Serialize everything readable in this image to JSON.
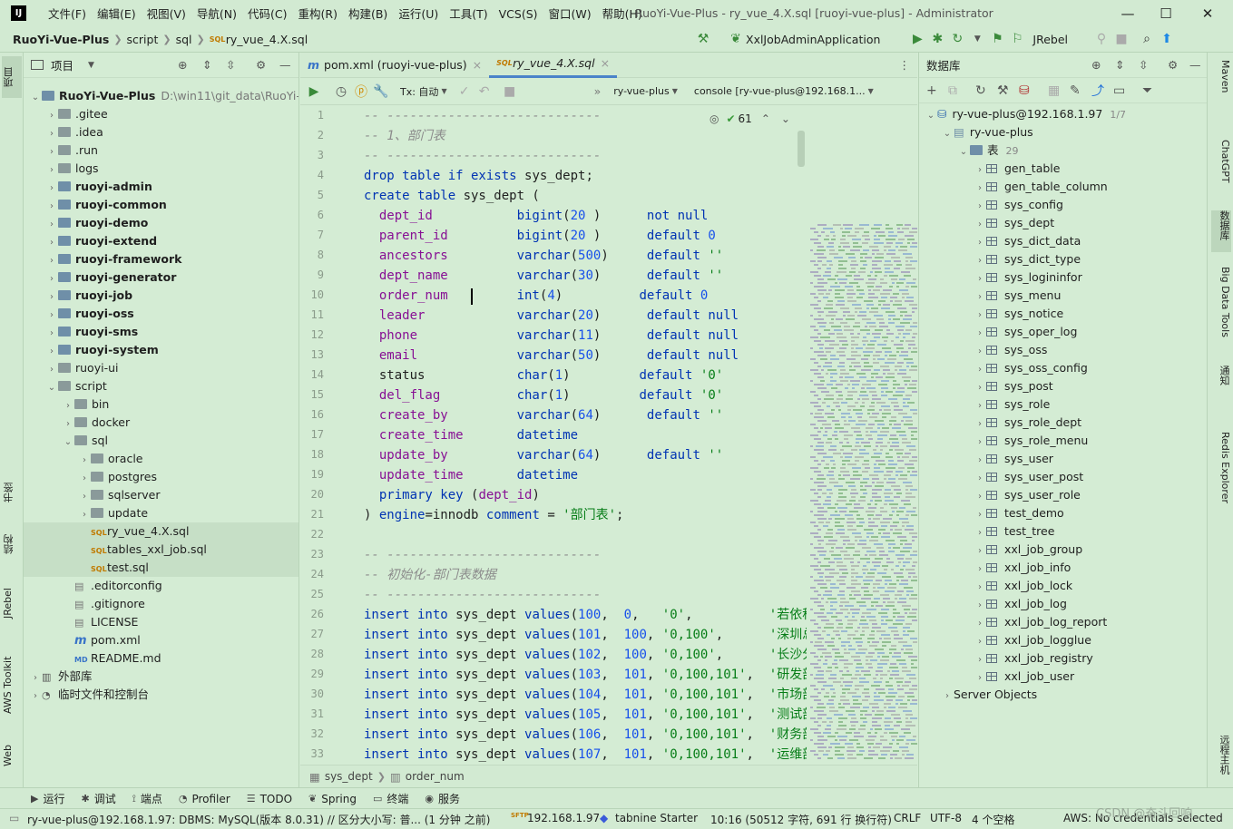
{
  "app": {
    "logo_text": "IJ",
    "window_title": "RuoYi-Vue-Plus - ry_vue_4.X.sql [ruoyi-vue-plus] - Administrator",
    "menu": [
      "文件(F)",
      "编辑(E)",
      "视图(V)",
      "导航(N)",
      "代码(C)",
      "重构(R)",
      "构建(B)",
      "运行(U)",
      "工具(T)",
      "VCS(S)",
      "窗口(W)",
      "帮助(H)"
    ],
    "window_buttons": {
      "minimize": "—",
      "maximize": "☐",
      "close": "✕"
    }
  },
  "navbar": {
    "breadcrumbs": [
      "RuoYi-Vue-Plus",
      "script",
      "sql",
      "ry_vue_4.X.sql"
    ],
    "run_config": "XxlJobAdminApplication",
    "jrebel": "JRebel"
  },
  "left_strip": {
    "tabs": [
      "项目",
      "书签",
      "结构",
      "JRebel",
      "AWS Toolkit",
      "Web"
    ]
  },
  "project_panel": {
    "title": "项目",
    "root": {
      "name": "RuoYi-Vue-Plus",
      "path": "D:\\win11\\git_data\\RuoYi-Vu"
    },
    "tree": [
      {
        "label": "RuoYi-Vue-Plus",
        "level": 0,
        "kind": "root",
        "expanded": true
      },
      {
        "label": ".gitee",
        "level": 1,
        "kind": "folder"
      },
      {
        "label": ".idea",
        "level": 1,
        "kind": "folder"
      },
      {
        "label": ".run",
        "level": 1,
        "kind": "folder"
      },
      {
        "label": "logs",
        "level": 1,
        "kind": "folder"
      },
      {
        "label": "ruoyi-admin",
        "level": 1,
        "kind": "module"
      },
      {
        "label": "ruoyi-common",
        "level": 1,
        "kind": "module"
      },
      {
        "label": "ruoyi-demo",
        "level": 1,
        "kind": "module"
      },
      {
        "label": "ruoyi-extend",
        "level": 1,
        "kind": "module"
      },
      {
        "label": "ruoyi-framework",
        "level": 1,
        "kind": "module"
      },
      {
        "label": "ruoyi-generator",
        "level": 1,
        "kind": "module"
      },
      {
        "label": "ruoyi-job",
        "level": 1,
        "kind": "module"
      },
      {
        "label": "ruoyi-oss",
        "level": 1,
        "kind": "module"
      },
      {
        "label": "ruoyi-sms",
        "level": 1,
        "kind": "module"
      },
      {
        "label": "ruoyi-system",
        "level": 1,
        "kind": "module"
      },
      {
        "label": "ruoyi-ui",
        "level": 1,
        "kind": "folder"
      },
      {
        "label": "script",
        "level": 1,
        "kind": "folder",
        "expanded": true
      },
      {
        "label": "bin",
        "level": 2,
        "kind": "folder"
      },
      {
        "label": "docker",
        "level": 2,
        "kind": "folder"
      },
      {
        "label": "sql",
        "level": 2,
        "kind": "folder",
        "expanded": true
      },
      {
        "label": "oracle",
        "level": 3,
        "kind": "folder"
      },
      {
        "label": "postgres",
        "level": 3,
        "kind": "folder"
      },
      {
        "label": "sqlserver",
        "level": 3,
        "kind": "folder"
      },
      {
        "label": "update",
        "level": 3,
        "kind": "folder"
      },
      {
        "label": "ry_vue_4.X.sql",
        "level": 3,
        "kind": "sql",
        "selected": true
      },
      {
        "label": "tables_xxl_job.sql",
        "level": 3,
        "kind": "sql",
        "selected": true
      },
      {
        "label": "test.sql",
        "level": 3,
        "kind": "sql",
        "selected": true
      },
      {
        "label": ".editorconfig",
        "level": 2,
        "kind": "file"
      },
      {
        "label": ".gitignore",
        "level": 2,
        "kind": "file"
      },
      {
        "label": "LICENSE",
        "level": 2,
        "kind": "file"
      },
      {
        "label": "pom.xml",
        "level": 2,
        "kind": "pom"
      },
      {
        "label": "README.md",
        "level": 2,
        "kind": "md"
      },
      {
        "label": "外部库",
        "level": 0,
        "kind": "lib"
      },
      {
        "label": "临时文件和控制台",
        "level": 0,
        "kind": "scratch"
      }
    ]
  },
  "editor": {
    "tabs": [
      {
        "label": "pom.xml (ruoyi-vue-plus)",
        "active": false
      },
      {
        "label": "ry_vue_4.X.sql",
        "active": true
      }
    ],
    "toolbar": {
      "tx": "Tx: 自动",
      "schema": "ry-vue-plus",
      "console": "console [ry-vue-plus@192.168.1..."
    },
    "inspections": "61",
    "breadcrumbs": [
      "sys_dept",
      "order_num"
    ],
    "line_numbers": [
      "1",
      "2",
      "3",
      "4",
      "5",
      "6",
      "7",
      "8",
      "9",
      "10",
      "11",
      "12",
      "13",
      "14",
      "15",
      "16",
      "17",
      "18",
      "19",
      "20",
      "21",
      "22",
      "23",
      "24",
      "25",
      "26",
      "27",
      "28",
      "29",
      "30",
      "31",
      "32",
      "33"
    ],
    "lines": [
      [
        [
          "cm",
          "-- ----------------------------"
        ]
      ],
      [
        [
          "cm",
          "-- 1、部门表"
        ]
      ],
      [
        [
          "cm",
          "-- ----------------------------"
        ]
      ],
      [
        [
          "kw",
          "drop table if exists "
        ],
        [
          "",
          "sys_dept;"
        ]
      ],
      [
        [
          "kw",
          "create table "
        ],
        [
          "",
          "sys_dept ("
        ]
      ],
      [
        [
          "col",
          "  dept_id           "
        ],
        [
          "kw",
          "bigint"
        ],
        [
          "",
          "("
        ],
        [
          "num",
          "20"
        ],
        [
          "",
          " )      "
        ],
        [
          "kw",
          "not null"
        ]
      ],
      [
        [
          "col",
          "  parent_id         "
        ],
        [
          "kw",
          "bigint"
        ],
        [
          "",
          "("
        ],
        [
          "num",
          "20"
        ],
        [
          "",
          " )      "
        ],
        [
          "kw",
          "default "
        ],
        [
          "num",
          "0"
        ]
      ],
      [
        [
          "col",
          "  ancestors         "
        ],
        [
          "kw",
          "varchar"
        ],
        [
          "",
          "("
        ],
        [
          "num",
          "500"
        ],
        [
          "",
          ")     "
        ],
        [
          "kw",
          "default "
        ],
        [
          "str",
          "''"
        ]
      ],
      [
        [
          "col",
          "  dept_name         "
        ],
        [
          "kw",
          "varchar"
        ],
        [
          "",
          "("
        ],
        [
          "num",
          "30"
        ],
        [
          "",
          ")      "
        ],
        [
          "kw",
          "default "
        ],
        [
          "str",
          "''"
        ]
      ],
      [
        [
          "col",
          "  order_num         "
        ],
        [
          "kw",
          "int"
        ],
        [
          "",
          "("
        ],
        [
          "num",
          "4"
        ],
        [
          "",
          ")          "
        ],
        [
          "kw",
          "default "
        ],
        [
          "num",
          "0"
        ]
      ],
      [
        [
          "col",
          "  leader            "
        ],
        [
          "kw",
          "varchar"
        ],
        [
          "",
          "("
        ],
        [
          "num",
          "20"
        ],
        [
          "",
          ")      "
        ],
        [
          "kw",
          "default null"
        ]
      ],
      [
        [
          "col",
          "  phone             "
        ],
        [
          "kw",
          "varchar"
        ],
        [
          "",
          "("
        ],
        [
          "num",
          "11"
        ],
        [
          "",
          ")      "
        ],
        [
          "kw",
          "default null"
        ]
      ],
      [
        [
          "col",
          "  email             "
        ],
        [
          "kw",
          "varchar"
        ],
        [
          "",
          "("
        ],
        [
          "num",
          "50"
        ],
        [
          "",
          ")      "
        ],
        [
          "kw",
          "default null"
        ]
      ],
      [
        [
          "",
          "  status            "
        ],
        [
          "kw",
          "char"
        ],
        [
          "",
          "("
        ],
        [
          "num",
          "1"
        ],
        [
          "",
          ")         "
        ],
        [
          "kw",
          "default "
        ],
        [
          "str",
          "'0'"
        ]
      ],
      [
        [
          "col",
          "  del_flag          "
        ],
        [
          "kw",
          "char"
        ],
        [
          "",
          "("
        ],
        [
          "num",
          "1"
        ],
        [
          "",
          ")         "
        ],
        [
          "kw",
          "default "
        ],
        [
          "str",
          "'0'"
        ]
      ],
      [
        [
          "col",
          "  create_by         "
        ],
        [
          "kw",
          "varchar"
        ],
        [
          "",
          "("
        ],
        [
          "num",
          "64"
        ],
        [
          "",
          ")      "
        ],
        [
          "kw",
          "default "
        ],
        [
          "str",
          "''"
        ]
      ],
      [
        [
          "col",
          "  create_time       "
        ],
        [
          "kw",
          "datetime"
        ]
      ],
      [
        [
          "col",
          "  update_by         "
        ],
        [
          "kw",
          "varchar"
        ],
        [
          "",
          "("
        ],
        [
          "num",
          "64"
        ],
        [
          "",
          ")      "
        ],
        [
          "kw",
          "default "
        ],
        [
          "str",
          "''"
        ]
      ],
      [
        [
          "col",
          "  update_time       "
        ],
        [
          "kw",
          "datetime"
        ]
      ],
      [
        [
          "kw",
          "  primary key "
        ],
        [
          "",
          "("
        ],
        [
          "col",
          "dept_id"
        ],
        [
          "",
          ")"
        ]
      ],
      [
        [
          "",
          ") "
        ],
        [
          "kw",
          "engine"
        ],
        [
          "",
          "=innodb "
        ],
        [
          "kw",
          "comment "
        ],
        [
          "",
          "= "
        ],
        [
          "str",
          "'部门表'"
        ],
        [
          "",
          ";"
        ]
      ],
      [
        [
          "",
          ""
        ]
      ],
      [
        [
          "cm",
          "-- ----------------------------"
        ]
      ],
      [
        [
          "cm",
          "-- 初始化-部门表数据"
        ]
      ],
      [
        [
          "cm",
          "-- ----------------------------"
        ]
      ],
      [
        [
          "kw",
          "insert into "
        ],
        [
          "",
          "sys_dept "
        ],
        [
          "kw",
          "values"
        ],
        [
          "",
          "("
        ],
        [
          "num",
          "100"
        ],
        [
          "",
          ",  "
        ],
        [
          "num",
          "0"
        ],
        [
          "",
          ",   "
        ],
        [
          "str",
          "'0'"
        ],
        [
          "",
          ",          "
        ],
        [
          "str",
          "'若依科技'"
        ]
      ],
      [
        [
          "kw",
          "insert into "
        ],
        [
          "",
          "sys_dept "
        ],
        [
          "kw",
          "values"
        ],
        [
          "",
          "("
        ],
        [
          "num",
          "101"
        ],
        [
          "",
          ",  "
        ],
        [
          "num",
          "100"
        ],
        [
          "",
          ", "
        ],
        [
          "str",
          "'0,100'"
        ],
        [
          "",
          ",      "
        ],
        [
          "str",
          "'深圳总公'"
        ]
      ],
      [
        [
          "kw",
          "insert into "
        ],
        [
          "",
          "sys_dept "
        ],
        [
          "kw",
          "values"
        ],
        [
          "",
          "("
        ],
        [
          "num",
          "102"
        ],
        [
          "",
          ",  "
        ],
        [
          "num",
          "100"
        ],
        [
          "",
          ", "
        ],
        [
          "str",
          "'0,100'"
        ],
        [
          "",
          ",      "
        ],
        [
          "str",
          "'长沙分公'"
        ]
      ],
      [
        [
          "kw",
          "insert into "
        ],
        [
          "",
          "sys_dept "
        ],
        [
          "kw",
          "values"
        ],
        [
          "",
          "("
        ],
        [
          "num",
          "103"
        ],
        [
          "",
          ",  "
        ],
        [
          "num",
          "101"
        ],
        [
          "",
          ", "
        ],
        [
          "str",
          "'0,100,101'"
        ],
        [
          "",
          ",  "
        ],
        [
          "str",
          "'研发部门'"
        ]
      ],
      [
        [
          "kw",
          "insert into "
        ],
        [
          "",
          "sys_dept "
        ],
        [
          "kw",
          "values"
        ],
        [
          "",
          "("
        ],
        [
          "num",
          "104"
        ],
        [
          "",
          ",  "
        ],
        [
          "num",
          "101"
        ],
        [
          "",
          ", "
        ],
        [
          "str",
          "'0,100,101'"
        ],
        [
          "",
          ",  "
        ],
        [
          "str",
          "'市场部门'"
        ]
      ],
      [
        [
          "kw",
          "insert into "
        ],
        [
          "",
          "sys_dept "
        ],
        [
          "kw",
          "values"
        ],
        [
          "",
          "("
        ],
        [
          "num",
          "105"
        ],
        [
          "",
          ",  "
        ],
        [
          "num",
          "101"
        ],
        [
          "",
          ", "
        ],
        [
          "str",
          "'0,100,101'"
        ],
        [
          "",
          ",  "
        ],
        [
          "str",
          "'测试部门'"
        ]
      ],
      [
        [
          "kw",
          "insert into "
        ],
        [
          "",
          "sys_dept "
        ],
        [
          "kw",
          "values"
        ],
        [
          "",
          "("
        ],
        [
          "num",
          "106"
        ],
        [
          "",
          ",  "
        ],
        [
          "num",
          "101"
        ],
        [
          "",
          ", "
        ],
        [
          "str",
          "'0,100,101'"
        ],
        [
          "",
          ",  "
        ],
        [
          "str",
          "'财务部门'"
        ]
      ],
      [
        [
          "kw",
          "insert into "
        ],
        [
          "",
          "sys_dept "
        ],
        [
          "kw",
          "values"
        ],
        [
          "",
          "("
        ],
        [
          "num",
          "107"
        ],
        [
          "",
          ",  "
        ],
        [
          "num",
          "101"
        ],
        [
          "",
          ", "
        ],
        [
          "str",
          "'0,100,101'"
        ],
        [
          "",
          ",  "
        ],
        [
          "str",
          "'运维部门'"
        ]
      ]
    ]
  },
  "db_panel": {
    "title": "数据库",
    "connection": "ry-vue-plus@192.168.1.97",
    "connection_count": "1/7",
    "schema": "ry-vue-plus",
    "tables_label": "表",
    "tables_count": "29",
    "tables": [
      "gen_table",
      "gen_table_column",
      "sys_config",
      "sys_dept",
      "sys_dict_data",
      "sys_dict_type",
      "sys_logininfor",
      "sys_menu",
      "sys_notice",
      "sys_oper_log",
      "sys_oss",
      "sys_oss_config",
      "sys_post",
      "sys_role",
      "sys_role_dept",
      "sys_role_menu",
      "sys_user",
      "sys_user_post",
      "sys_user_role",
      "test_demo",
      "test_tree",
      "xxl_job_group",
      "xxl_job_info",
      "xxl_job_lock",
      "xxl_job_log",
      "xxl_job_log_report",
      "xxl_job_logglue",
      "xxl_job_registry",
      "xxl_job_user"
    ],
    "server_objects": "Server Objects"
  },
  "right_strip": {
    "tabs": [
      "Maven",
      "ChatGPT",
      "数据库",
      "Big Data Tools",
      "通知",
      "Redis Explorer",
      "远程主机"
    ]
  },
  "toolwindows": [
    "运行",
    "调试",
    "端点",
    "Profiler",
    "TODO",
    "Spring",
    "终端",
    "服务"
  ],
  "status": {
    "left": "ry-vue-plus@192.168.1.97: DBMS: MySQL(版本 8.0.31) // 区分大小写: 普... (1 分钟 之前)",
    "host": "192.168.1.97",
    "tabnine": "tabnine Starter",
    "position": "10:16 (50512 字符, 691 行 换行符)",
    "line_sep": "CRLF",
    "encoding": "UTF-8",
    "indent": "4 个空格",
    "aws": "AWS: No credentials selected",
    "watermark": "CSDN @奋斗回响"
  }
}
